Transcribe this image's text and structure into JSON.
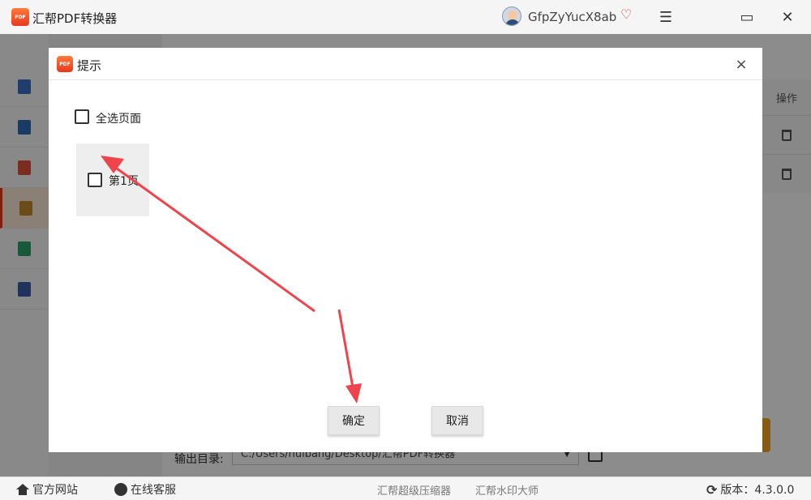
{
  "app": {
    "title": "汇帮PDF转换器",
    "logo_text": "PDF",
    "user_name": "GfpZyYucX8ab",
    "accent_color": "#e9381e"
  },
  "window_controls": {
    "menu_icon": "☰",
    "maximize_icon": "▭",
    "close_icon": "✕"
  },
  "background": {
    "column_header": "操作",
    "output_label": "输出目录:",
    "output_path": "C:/Users/huibang/Desktop/汇帮PDF转换器",
    "sidebar_icons": [
      "word-icon",
      "excel-icon",
      "ppt-icon",
      "image-icon",
      "txt-icon",
      "epub-icon"
    ]
  },
  "dialog": {
    "title": "提示",
    "close_symbol": "×",
    "select_all_label": "全选页面",
    "pages": [
      {
        "label": "第1页",
        "checked": false
      }
    ],
    "confirm_label": "确定",
    "cancel_label": "取消"
  },
  "statusbar": {
    "website": "官方网站",
    "support": "在线客服",
    "link1": "汇帮超级压缩器",
    "link2": "汇帮水印大师",
    "version": "版本：4.3.0.0"
  },
  "annotation_color": "#f0444c"
}
